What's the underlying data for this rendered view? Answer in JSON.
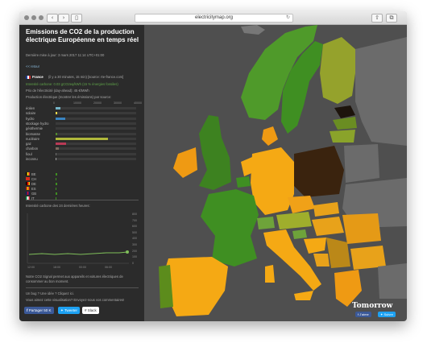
{
  "browser": {
    "url": "electricitymap.org"
  },
  "panel": {
    "title": "Emissions de CO2 de la production électrique Européenne en temps réel",
    "last_update": "Dernière mise à jour: 3 mars 2017 11:14 UTC+01:00",
    "back": "<< retour",
    "country_line": "France",
    "country_meta": "(il y a 30 minutes, 15 min) [source: rte-france.com]",
    "carbon_intensity": "Intensité carbone: 0.03 gCO2eq/kWh (15 % énergies fossiles)",
    "price": "Prix de l'électricité (day-ahead): 45 €/MWh",
    "production_label": "Production électrique (montrer les émissions) par source:",
    "axis_ticks": [
      "0",
      "10000",
      "20000",
      "30000",
      "40000"
    ],
    "sources": [
      {
        "label": "éolien",
        "value": 2500,
        "color": "#75b5c8"
      },
      {
        "label": "solaire",
        "value": 800,
        "color": "#f0d84a"
      },
      {
        "label": "hydro",
        "value": 4800,
        "color": "#3a84c1"
      },
      {
        "label": "stockage hydro",
        "value": 0,
        "color": "#3a84c1"
      },
      {
        "label": "géothermie",
        "value": 0,
        "color": "#9c6b49"
      },
      {
        "label": "biomasse",
        "value": 700,
        "color": "#4f8a2f"
      },
      {
        "label": "nucléaire",
        "value": 26000,
        "color": "#b0b83b"
      },
      {
        "label": "gaz",
        "value": 5000,
        "color": "#b93a56"
      },
      {
        "label": "charbon",
        "value": 1500,
        "color": "#7b6a5d"
      },
      {
        "label": "fioul",
        "value": 400,
        "color": "#6d6d6d"
      },
      {
        "label": "inconnu",
        "value": 300,
        "color": "#9d9d9d"
      }
    ],
    "exchanges": [
      {
        "code": "BE",
        "value": 600
      },
      {
        "code": "CH",
        "value": 400
      },
      {
        "code": "DE",
        "value": 900
      },
      {
        "code": "ES",
        "value": 500
      },
      {
        "code": "GB",
        "value": 800
      },
      {
        "code": "IT",
        "value": 300
      }
    ],
    "history_label": "Intensité carbone des 24 dernières heures:",
    "history_ticks": [
      "800",
      "700",
      "600",
      "500",
      "400",
      "300",
      "200",
      "100",
      "0"
    ],
    "history_x": [
      "12:00",
      "18:00",
      "00:00",
      "06:00"
    ],
    "cta_1": "Notre CO2 Signal permet aux appareils et voitures électriques de consommer au bon moment.",
    "bug": "Un bug ? Une idée ? Cliquez ici.",
    "like": "Vous aimez cette visualisation? Envoyez-nous vos commentaires!",
    "share_fb": "Partager  50 K",
    "share_tw": "Tweeter",
    "share_slack": "Slack"
  },
  "map": {
    "brand": "Tomorrow",
    "like": "J'aime",
    "follow": "Suivre"
  }
}
